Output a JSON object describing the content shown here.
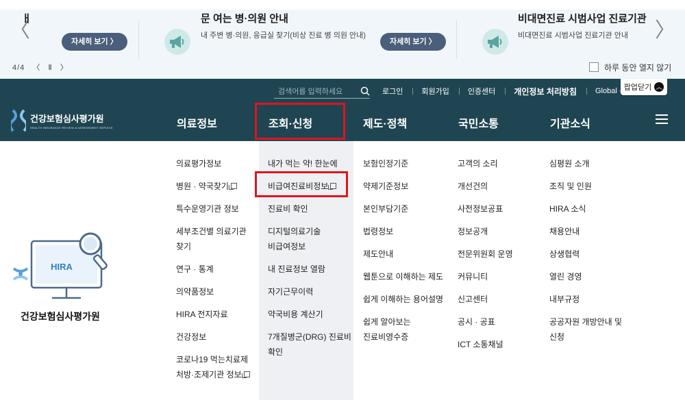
{
  "popup": {
    "slide_left": {
      "title": "ㅐ",
      "button": "자세히 보기 〉"
    },
    "slide_mid": {
      "title": "문 여는 병·의원 안내",
      "subtitle": "내 주변 병·의원, 응급실 찾기(비상 진료 병 의원 안내)",
      "button": "자세히 보기 〉"
    },
    "slide_right": {
      "title": "비대면진료 시범사업 진료기관",
      "subtitle": "비대면진료 시범사업 진료기관 안내"
    },
    "pager": {
      "count": "4/4",
      "prev": "〈",
      "pause": "Ⅱ",
      "next": "〉"
    },
    "close_today": "하루 동안 열지 않기",
    "close_popup": "팝업닫기",
    "arrow_prev": "〈",
    "arrow_next": "〉"
  },
  "header": {
    "search_placeholder": "검색어를 입력하세요",
    "util": {
      "login": "로그인",
      "join": "회원가입",
      "cert": "인증센터",
      "privacy": "개인정보 처리방침",
      "global": "Global ⌵"
    },
    "logo": {
      "ko": "건강보험심사평가원",
      "en": "HEALTH INSURANCE REVIEW & ASSESSMENT SERVICE"
    },
    "gnb": [
      "의료정보",
      "조회·신청",
      "제도·정책",
      "국민소통",
      "기관소식"
    ]
  },
  "menu": {
    "col1": [
      "의료평가정보",
      "병원 · 약국찾기",
      "특수운영기관 정보",
      "세부조건별 의료기관",
      "찾기",
      "연구 · 통계",
      "의약품정보",
      "HIRA 전지자료",
      "건강정보",
      "코로나19 먹는치료제",
      "처방·조제기관 정보"
    ],
    "col2": [
      "내가 먹는 약! 한눈에",
      "비급여진료비정보",
      "진료비 확인",
      "디지털의료기술",
      "비급여정보",
      "내 진료정보 열람",
      "자기근무이력",
      "약국비용 계산기",
      "7개질병군(DRG) 진료비",
      "확인"
    ],
    "col3": [
      "보험인정기준",
      "약제기준정보",
      "본인부담기준",
      "법령정보",
      "제도안내",
      "웹툰으로 이해하는 제도",
      "쉽게 이해하는 용어설명",
      "쉽게 알아보는",
      "진료비영수증"
    ],
    "col4": [
      "고객의 소리",
      "개선건의",
      "사전정보공표",
      "정보공개",
      "전문위원회 운영",
      "커뮤니티",
      "신고센터",
      "공시 · 공표",
      "ICT 소통채널"
    ],
    "col5": [
      "심평원 소개",
      "조직 및 인원",
      "HIRA 소식",
      "채용안내",
      "상생협력",
      "열린 경영",
      "내부규정",
      "공공자원 개방안내 및",
      "신청"
    ]
  },
  "illustration": {
    "badge": "HIRA",
    "name": "건강보험심사평가원"
  },
  "colors": {
    "header_bg": "#1f4552",
    "popup_bg": "#f1f6fb",
    "highlight": "#e0141e",
    "button": "#4b5e7a"
  }
}
